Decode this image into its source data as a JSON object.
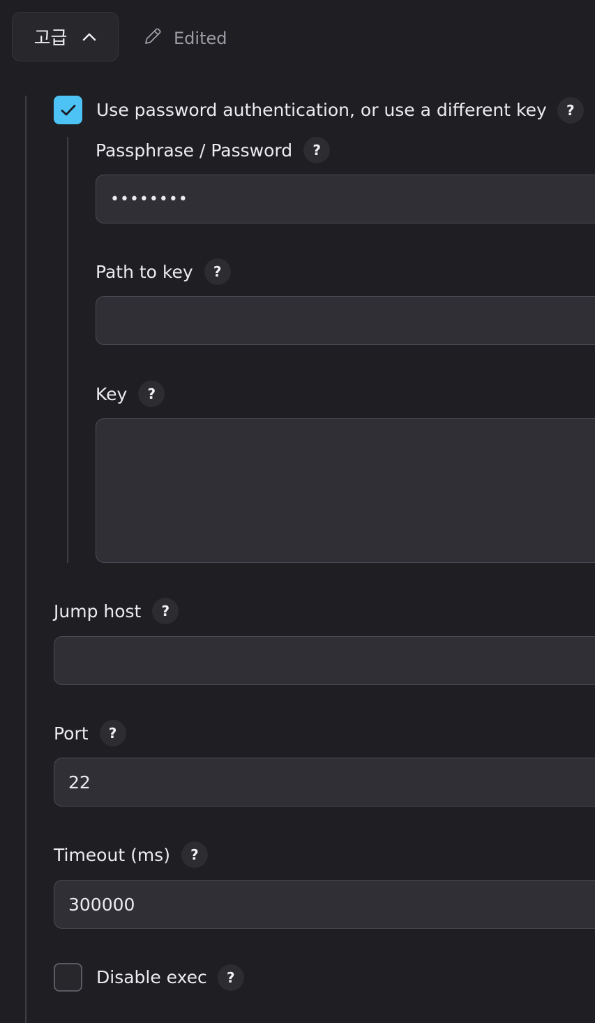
{
  "header": {
    "advanced_label": "고급",
    "edited_label": "Edited"
  },
  "use_password": {
    "checked": true,
    "label": "Use password authentication, or use a different key",
    "help": "?"
  },
  "passphrase": {
    "label": "Passphrase / Password",
    "help": "?",
    "value": "••••••••"
  },
  "path_to_key": {
    "label": "Path to key",
    "help": "?",
    "value": ""
  },
  "key": {
    "label": "Key",
    "help": "?",
    "value": ""
  },
  "jump_host": {
    "label": "Jump host",
    "help": "?",
    "value": ""
  },
  "port": {
    "label": "Port",
    "help": "?",
    "value": "22"
  },
  "timeout": {
    "label": "Timeout (ms)",
    "help": "?",
    "value": "300000"
  },
  "disable_exec": {
    "checked": false,
    "label": "Disable exec",
    "help": "?"
  },
  "colors": {
    "background": "#1f1f23",
    "field_background": "#2f2f35",
    "checkbox_accent": "#4cc2f5"
  },
  "icons": {
    "advanced_toggle": "chevron-up-icon",
    "edited": "pencil-icon",
    "checkbox_check": "check-icon",
    "help": "question-mark-icon"
  }
}
